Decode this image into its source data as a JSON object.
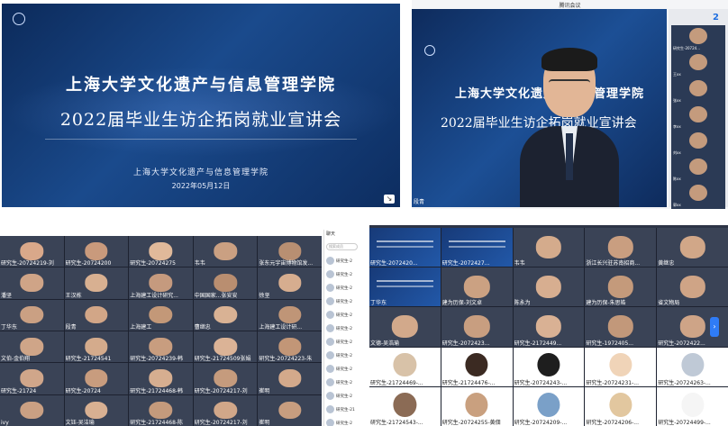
{
  "slide": {
    "title_line1": "上海大学文化遗产与信息管理学院",
    "title_line2": "2022届毕业生访企拓岗就业宣讲会",
    "org": "上海大学文化遗产与信息管理学院",
    "date": "2022年05月12日"
  },
  "speaker_view": {
    "window_title": "腾讯会议",
    "slide_line1": "上海大学文化遗产与信息管理学院",
    "slide_line2": "2022届毕业生访企拓岗就业宣讲会",
    "speaker_name": "段青",
    "participant_count": "2",
    "side_tiles": [
      "研究生-20724...",
      "王xx",
      "张xx",
      "李xx",
      "刘xx",
      "陈xx",
      "郭xx"
    ]
  },
  "grid_left": {
    "cells": [
      {
        "label": "研究生-20724219-刘",
        "kind": "person",
        "color": "#d9a88a"
      },
      {
        "label": "研究生-20724200",
        "kind": "person",
        "color": "#c99a7c"
      },
      {
        "label": "研究生-20724275",
        "kind": "person",
        "color": "#e0b99a"
      },
      {
        "label": "韦韦",
        "kind": "person",
        "color": "#caa082"
      },
      {
        "label": "张东元宇宙博物馆发...",
        "kind": "person",
        "color": "#b88f72"
      },
      {
        "label": "潘坚",
        "kind": "person",
        "color": "#cfa487"
      },
      {
        "label": "王汉栋",
        "kind": "person",
        "color": "#d8b091"
      },
      {
        "label": "上海建工设计研究...",
        "kind": "person",
        "color": "#c59a7e"
      },
      {
        "label": "中国国家...张安安",
        "kind": "person",
        "color": "#b98e70"
      },
      {
        "label": "徐坚",
        "kind": "person",
        "color": "#d6ad8f"
      },
      {
        "label": "丁华东",
        "kind": "person",
        "color": "#caa083"
      },
      {
        "label": "段青",
        "kind": "person",
        "color": "#d2a687"
      },
      {
        "label": "上海建工",
        "kind": "person",
        "color": "#c39878"
      },
      {
        "label": "曹继忠",
        "kind": "person",
        "color": "#d9b294"
      },
      {
        "label": "上海建工设计研...",
        "kind": "person",
        "color": "#bf9577"
      },
      {
        "label": "文伯-金伯翔",
        "kind": "person",
        "color": "#cfa588"
      },
      {
        "label": "研究生-21724541",
        "kind": "person",
        "color": "#d4ab8c"
      },
      {
        "label": "研究生-20724239-韩",
        "kind": "person",
        "color": "#c89d7f"
      },
      {
        "label": "研究生-21724509张娟",
        "kind": "person",
        "color": "#dbb396"
      },
      {
        "label": "研究生-20724223-朱",
        "kind": "person",
        "color": "#c29677"
      },
      {
        "label": "研究生-21724",
        "kind": "person",
        "color": "#d0a68a"
      },
      {
        "label": "研究生-20724",
        "kind": "person",
        "color": "#c89c7e"
      },
      {
        "label": "研究生-21724468-韩",
        "kind": "person",
        "color": "#d6ae90"
      },
      {
        "label": "研究生-20724217-刘",
        "kind": "person",
        "color": "#c59b7d"
      },
      {
        "label": "崔明",
        "kind": "person",
        "color": "#d3a98b"
      },
      {
        "label": "ivy",
        "kind": "person",
        "color": "#caa083"
      },
      {
        "label": "文钰-吴洁瑜",
        "kind": "person",
        "color": "#d8b092"
      },
      {
        "label": "研究生-21724468-陈",
        "kind": "person",
        "color": "#c49a7c"
      },
      {
        "label": "研究生-20724217-刘",
        "kind": "person",
        "color": "#d1a789"
      },
      {
        "label": "崔明",
        "kind": "person",
        "color": "#c79d7f"
      }
    ],
    "sidebar": {
      "header": "聊天",
      "search_placeholder": "搜索成员",
      "members": [
        "研究生-2",
        "研究生-2",
        "研究生-2",
        "研究生-2",
        "研究生-2",
        "研究生-2",
        "研究生-2",
        "研究生-2",
        "研究生-2",
        "研究生-2",
        "研究生-2",
        "研究生-21",
        "研究生-2"
      ]
    }
  },
  "grid_right": {
    "cells": [
      {
        "label": "研究生-2072420...",
        "kind": "slide",
        "color": "#000"
      },
      {
        "label": "研究生-2072427...",
        "kind": "slide",
        "color": "#000"
      },
      {
        "label": "韦韦",
        "kind": "person",
        "color": "#d4ab8c"
      },
      {
        "label": "浙江长兴驻苏南招商...",
        "kind": "person",
        "color": "#c99e80"
      },
      {
        "label": "黄继忠",
        "kind": "person",
        "color": "#d1a788"
      },
      {
        "label": "丁华东",
        "kind": "slide",
        "color": "#000"
      },
      {
        "label": "建为历保-刘文卓",
        "kind": "person",
        "color": "#cba182"
      },
      {
        "label": "陈永为",
        "kind": "person",
        "color": "#d7ae90"
      },
      {
        "label": "建为历保-朱思皓",
        "kind": "person",
        "color": "#c49a7b"
      },
      {
        "label": "省文物局",
        "kind": "person",
        "color": "#cfa486"
      },
      {
        "label": "文德-吴浩瑜",
        "kind": "person",
        "color": "#d2a98b"
      },
      {
        "label": "研究生-2072423...",
        "kind": "person",
        "color": "#c89e80"
      },
      {
        "label": "研究生-2172449...",
        "kind": "person",
        "color": "#d9b194"
      },
      {
        "label": "研究生-1972405...",
        "kind": "person",
        "color": "#c2987a"
      },
      {
        "label": "研究生-2072422...",
        "kind": "person",
        "color": "#cea487"
      },
      {
        "label": "研究生-21724469-...",
        "kind": "round",
        "color": "#d8c2a8"
      },
      {
        "label": "研究生-21724476-...",
        "kind": "round",
        "color": "#3b2a22"
      },
      {
        "label": "研究生-20724243-...",
        "kind": "round",
        "color": "#1e1e1e"
      },
      {
        "label": "研究生-20724231-...",
        "kind": "round",
        "color": "#f0d4b8"
      },
      {
        "label": "研究生-20724263-...",
        "kind": "round",
        "color": "#bfc9d6"
      },
      {
        "label": "研究生-21724543-...",
        "kind": "round",
        "color": "#8b6b55"
      },
      {
        "label": "研究生-20724255-黄佃",
        "kind": "round",
        "color": "#c9a07f"
      },
      {
        "label": "研究生-20724209-...",
        "kind": "round",
        "color": "#7aa0c8"
      },
      {
        "label": "研究生-20724206-...",
        "kind": "round",
        "color": "#e2c79f"
      },
      {
        "label": "研究生-20724499-...",
        "kind": "round",
        "color": "#f5f5f5"
      }
    ]
  }
}
